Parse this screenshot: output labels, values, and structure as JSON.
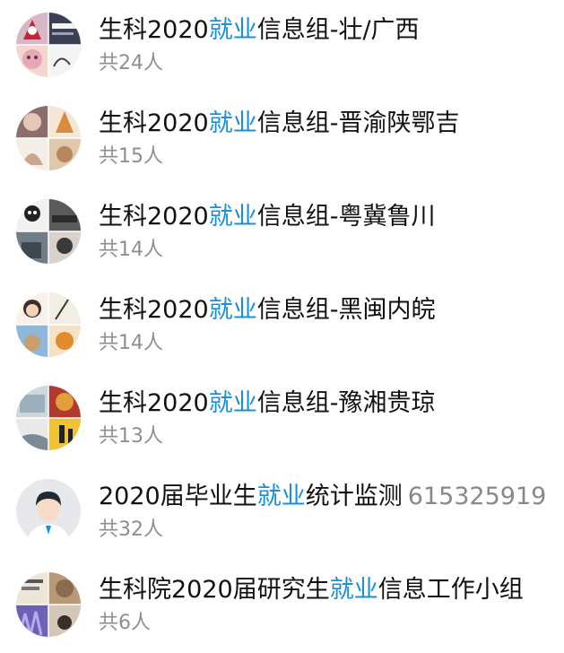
{
  "groups": [
    {
      "title_pre": "生科2020",
      "title_hl": "就业",
      "title_post": "信息组-壮/广西",
      "extra": "",
      "count": "共24人",
      "avatar_icon": "anime-collage-avatar-icon"
    },
    {
      "title_pre": "生科2020",
      "title_hl": "就业",
      "title_post": "信息组-晋渝陕鄂吉",
      "extra": "",
      "count": "共15人",
      "avatar_icon": "anime-collage-avatar-icon"
    },
    {
      "title_pre": "生科2020",
      "title_hl": "就业",
      "title_post": "信息组-粤冀鲁川",
      "extra": "",
      "count": "共14人",
      "avatar_icon": "photo-collage-avatar-icon"
    },
    {
      "title_pre": "生科2020",
      "title_hl": "就业",
      "title_post": "信息组-黑闽内皖",
      "extra": "",
      "count": "共14人",
      "avatar_icon": "cartoon-collage-avatar-icon"
    },
    {
      "title_pre": "生科2020",
      "title_hl": "就业",
      "title_post": "信息组-豫湘贵琼",
      "extra": "",
      "count": "共13人",
      "avatar_icon": "scenery-collage-avatar-icon"
    },
    {
      "title_pre": "2020届毕业生",
      "title_hl": "就业",
      "title_post": "统计监测",
      "extra": "615325919",
      "count": "共32人",
      "avatar_icon": "default-person-avatar-icon"
    },
    {
      "title_pre": "生科院2020届研究生",
      "title_hl": "就业",
      "title_post": "信息工作小组",
      "extra": "",
      "count": "共6人",
      "avatar_icon": "photo-collage-avatar-icon"
    }
  ],
  "colors": {
    "highlight": "#1a8fd9",
    "title": "#111111",
    "count": "#8f8f8f"
  }
}
